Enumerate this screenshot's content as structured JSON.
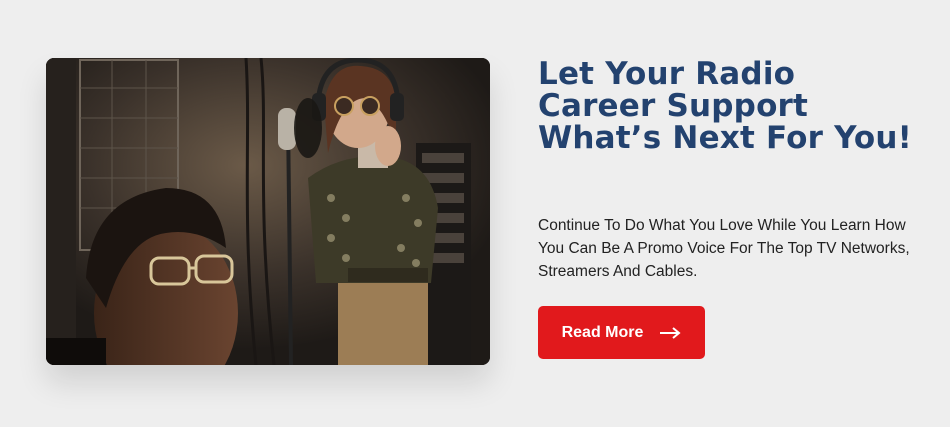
{
  "colors": {
    "background": "#eeeeee",
    "headline": "#23426f",
    "body_text": "#222222",
    "button": "#e1191c",
    "button_text": "#ffffff"
  },
  "hero": {
    "headline": "Let Your Radio Career Support What’s Next For You!",
    "description": "Continue To Do What You Love While You Learn How You Can Be A Promo Voice For The Top TV Networks, Streamers And Cables.",
    "cta_label": "Read More",
    "cta_icon": "arrow-right-icon",
    "image_subject": "recording-studio-photo"
  }
}
